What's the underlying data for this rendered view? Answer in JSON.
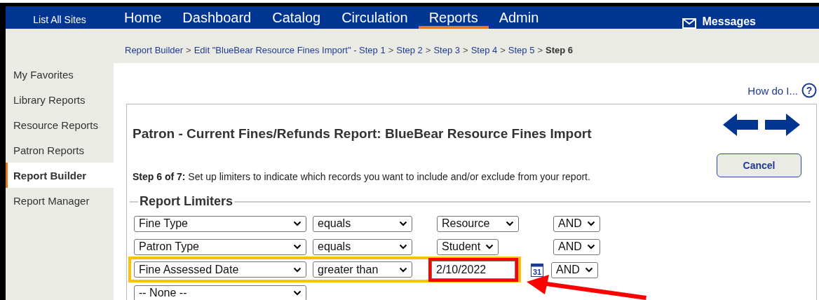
{
  "nav": {
    "sites_link": "List All Sites",
    "tabs": [
      {
        "label": "Home",
        "selected": false
      },
      {
        "label": "Dashboard",
        "selected": false
      },
      {
        "label": "Catalog",
        "selected": false
      },
      {
        "label": "Circulation",
        "selected": false
      },
      {
        "label": "Reports",
        "selected": true
      },
      {
        "label": "Admin",
        "selected": false
      }
    ],
    "messages": "Messages"
  },
  "breadcrumb": [
    {
      "label": "Report Builder",
      "separator": ">",
      "current": false
    },
    {
      "label": "Edit \"BlueBear Resource Fines Import\" - Step 1",
      "separator": ">",
      "current": false
    },
    {
      "label": "Step 2",
      "separator": ">",
      "current": false
    },
    {
      "label": "Step 3",
      "separator": ">",
      "current": false
    },
    {
      "label": "Step 4",
      "separator": ">",
      "current": false
    },
    {
      "label": "Step 5",
      "separator": ">",
      "current": false
    },
    {
      "label": "Step 6",
      "current": true
    }
  ],
  "sidebar": {
    "items": [
      {
        "label": "My Favorites",
        "selected": false
      },
      {
        "label": "Library Reports",
        "selected": false
      },
      {
        "label": "Resource Reports",
        "selected": false
      },
      {
        "label": "Patron Reports",
        "selected": false
      },
      {
        "label": "Report Builder",
        "selected": true
      },
      {
        "label": "Report Manager",
        "selected": false
      }
    ]
  },
  "help": {
    "label": "How do I...",
    "glyph": "?"
  },
  "report": {
    "title": "Patron - Current Fines/Refunds Report: BlueBear Resource Fines Import",
    "instructions": "**Step 6 of 7:** Set up limiters to indicate which records you want to include and/or exclude from your report.",
    "cancel": "Cancel"
  },
  "limiters": {
    "legend": "Report Limiters",
    "rows": [
      {
        "field": "Fine Type",
        "operator": "equals",
        "value": {
          "kind": "select",
          "text": "Resource",
          "highlighted": false
        },
        "conjunction": "AND",
        "highlighted": false
      },
      {
        "field": "Patron Type",
        "operator": "equals",
        "value": {
          "kind": "select",
          "text": "Student",
          "highlighted": false
        },
        "conjunction": "AND",
        "highlighted": false
      },
      {
        "field": "Fine Assessed Date",
        "operator": "greater than",
        "value": {
          "kind": "date",
          "text": "2/10/2022",
          "calendar": "31",
          "highlighted": true
        },
        "conjunction": "AND",
        "highlighted": true
      },
      {
        "field": "-- None --",
        "highlighted": false
      }
    ]
  },
  "annotations": [
    {
      "kind": "arrow"
    }
  ]
}
